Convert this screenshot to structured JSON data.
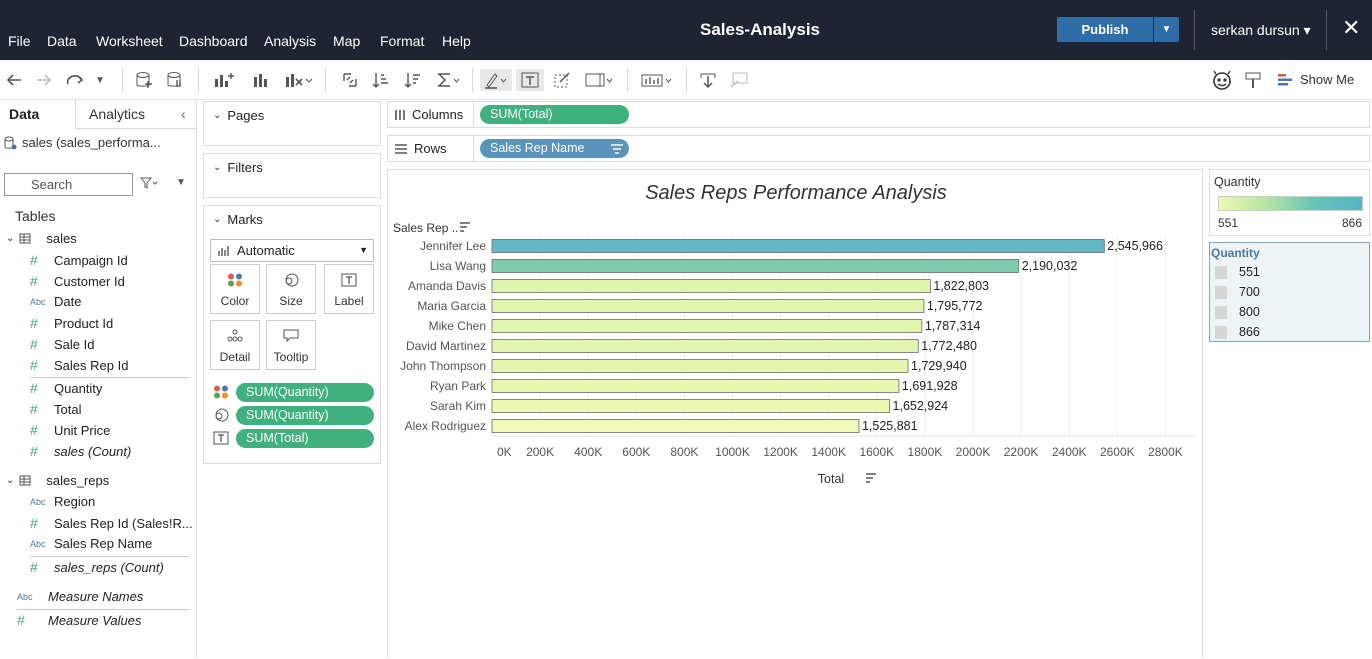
{
  "menu": [
    "File",
    "Data",
    "Worksheet",
    "Dashboard",
    "Analysis",
    "Map",
    "Format",
    "Help"
  ],
  "app_title": "Sales-Analysis",
  "publish_label": "Publish",
  "user_name": "serkan dursun ▾",
  "show_me_label": "Show Me",
  "data_pane": {
    "tab_data": "Data",
    "tab_analytics": "Analytics",
    "datasource": "sales (sales_performa...",
    "search_placeholder": "Search",
    "tables_label": "Tables",
    "tables": [
      {
        "name": "sales",
        "fields": [
          {
            "type": "measure",
            "label": "Campaign Id"
          },
          {
            "type": "measure",
            "label": "Customer Id"
          },
          {
            "type": "dimension",
            "label": "Date"
          },
          {
            "type": "measure",
            "label": "Product Id"
          },
          {
            "type": "measure",
            "label": "Sale Id"
          },
          {
            "type": "measure",
            "label": "Sales Rep Id"
          },
          {
            "type": "measure",
            "label": "Quantity"
          },
          {
            "type": "measure",
            "label": "Total"
          },
          {
            "type": "measure",
            "label": "Unit Price"
          },
          {
            "type": "measure",
            "label": "sales (Count)"
          }
        ]
      },
      {
        "name": "sales_reps",
        "fields": [
          {
            "type": "dimension",
            "label": "Region"
          },
          {
            "type": "measure",
            "label": "Sales Rep Id (Sales!R..."
          },
          {
            "type": "dimension",
            "label": "Sales Rep Name"
          },
          {
            "type": "measure",
            "label": "sales_reps (Count)"
          }
        ]
      }
    ],
    "measure_names": "Measure Names",
    "measure_values": "Measure Values"
  },
  "cards": {
    "pages": "Pages",
    "filters": "Filters",
    "marks": "Marks",
    "mark_type": "Automatic",
    "buttons": {
      "color": "Color",
      "size": "Size",
      "label": "Label",
      "detail": "Detail",
      "tooltip": "Tooltip"
    },
    "mark_pills": [
      "SUM(Quantity)",
      "SUM(Quantity)",
      "SUM(Total)"
    ]
  },
  "shelves": {
    "columns_label": "Columns",
    "columns_pill": "SUM(Total)",
    "rows_label": "Rows",
    "rows_pill": "Sales Rep Name"
  },
  "legends": {
    "color_title": "Quantity",
    "color_min": "551",
    "color_max": "866",
    "size_title": "Quantity",
    "size_items": [
      "551",
      "700",
      "800",
      "866"
    ]
  },
  "chart_data": {
    "type": "bar",
    "orientation": "horizontal",
    "title": "Sales Reps Performance Analysis",
    "ylabel": "Sales Rep ..",
    "xlabel": "Total",
    "categories": [
      "Jennifer Lee",
      "Lisa Wang",
      "Amanda Davis",
      "Maria Garcia",
      "Mike Chen",
      "David Martinez",
      "John Thompson",
      "Ryan Park",
      "Sarah Kim",
      "Alex Rodriguez"
    ],
    "values": [
      2545966,
      2190032,
      1822803,
      1795772,
      1787314,
      1772480,
      1729940,
      1691928,
      1652924,
      1525881
    ],
    "data_labels": [
      "2,545,966",
      "2,190,032",
      "1,822,803",
      "1,795,772",
      "1,787,314",
      "1,772,480",
      "1,729,940",
      "1,691,928",
      "1,652,924",
      "1,525,881"
    ],
    "color_fills": [
      "#62b9c4",
      "#7dccae",
      "#dff4ad",
      "#e3f5ae",
      "#e3f5ae",
      "#e3f5ae",
      "#e6f6b0",
      "#eaf7b1",
      "#edf8b3",
      "#f0f9b6"
    ],
    "xticks": [
      "0K",
      "200K",
      "400K",
      "600K",
      "800K",
      "1000K",
      "1200K",
      "1400K",
      "1600K",
      "1800K",
      "2000K",
      "2200K",
      "2400K",
      "2600K",
      "2800K"
    ],
    "xlim": [
      0,
      2800000
    ],
    "grid": true
  }
}
